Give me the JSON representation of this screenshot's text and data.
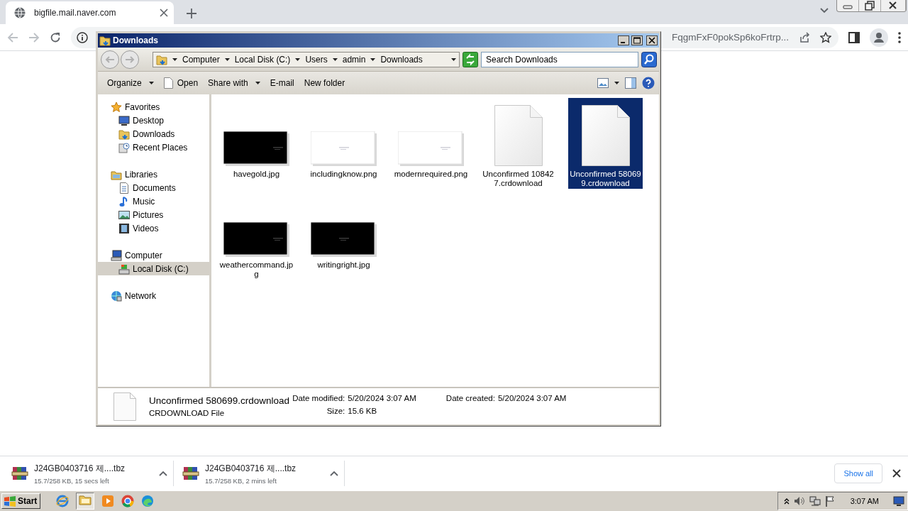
{
  "browser": {
    "tab": {
      "title": "bigfile.mail.naver.com",
      "selected": true
    },
    "address": "FqgmFxF0pokSp6koFrtrp..."
  },
  "explorer": {
    "title": "Downloads",
    "breadcrumb": [
      "Computer",
      "Local Disk (C:)",
      "Users",
      "admin",
      "Downloads"
    ],
    "search": {
      "placeholder": "Search Downloads"
    },
    "commands": [
      {
        "label": "Organize",
        "dropdown": true
      },
      {
        "label": "Open",
        "dropdown": false
      },
      {
        "label": "Share with",
        "dropdown": true
      },
      {
        "label": "E-mail",
        "dropdown": false
      },
      {
        "label": "New folder",
        "dropdown": false
      }
    ],
    "navigation": [
      {
        "label": "Favorites",
        "selected": false,
        "children": [
          {
            "label": "Desktop",
            "selected": false
          },
          {
            "label": "Downloads",
            "selected": false
          },
          {
            "label": "Recent Places",
            "selected": false
          }
        ]
      },
      {
        "label": "Libraries",
        "selected": false,
        "children": [
          {
            "label": "Documents",
            "selected": false
          },
          {
            "label": "Music",
            "selected": false
          },
          {
            "label": "Pictures",
            "selected": false
          },
          {
            "label": "Videos",
            "selected": false
          }
        ]
      },
      {
        "label": "Computer",
        "selected": false,
        "children": [
          {
            "label": "Local Disk (C:)",
            "selected": true
          }
        ]
      },
      {
        "label": "Network",
        "selected": false
      }
    ],
    "files": [
      {
        "name": "havegold.jpg",
        "selected": false
      },
      {
        "name": "includingknow.png",
        "selected": false
      },
      {
        "name": "modernrequired.png",
        "selected": false
      },
      {
        "name": "Unconfirmed 108427.crdownload",
        "kind": "document",
        "selected": false
      },
      {
        "name": "Unconfirmed 580699.crdownload",
        "kind": "document",
        "selected": true
      },
      {
        "name": "weathercommand.jpg",
        "selected": false
      },
      {
        "name": "writingright.jpg",
        "selected": false
      }
    ],
    "details": {
      "name": "Unconfirmed 580699.crdownload",
      "type": "CRDOWNLOAD File",
      "fields": [
        {
          "label": "Date modified:",
          "value": "5/20/2024 3:07 AM"
        },
        {
          "label": "Date created:",
          "value": "5/20/2024 3:07 AM"
        },
        {
          "label": "Size:",
          "value": "15.6 KB"
        }
      ]
    }
  },
  "downloads": {
    "items": [
      {
        "name": "J24GB0403716  제....tbz",
        "status": "15.7/258 KB, 15 secs left"
      },
      {
        "name": "J24GB0403716  제....tbz",
        "status": "15.7/258 KB, 2 mins left"
      }
    ],
    "show_all": "Show all"
  },
  "taskbar": {
    "start": "Start",
    "clock": "3:07 AM"
  }
}
